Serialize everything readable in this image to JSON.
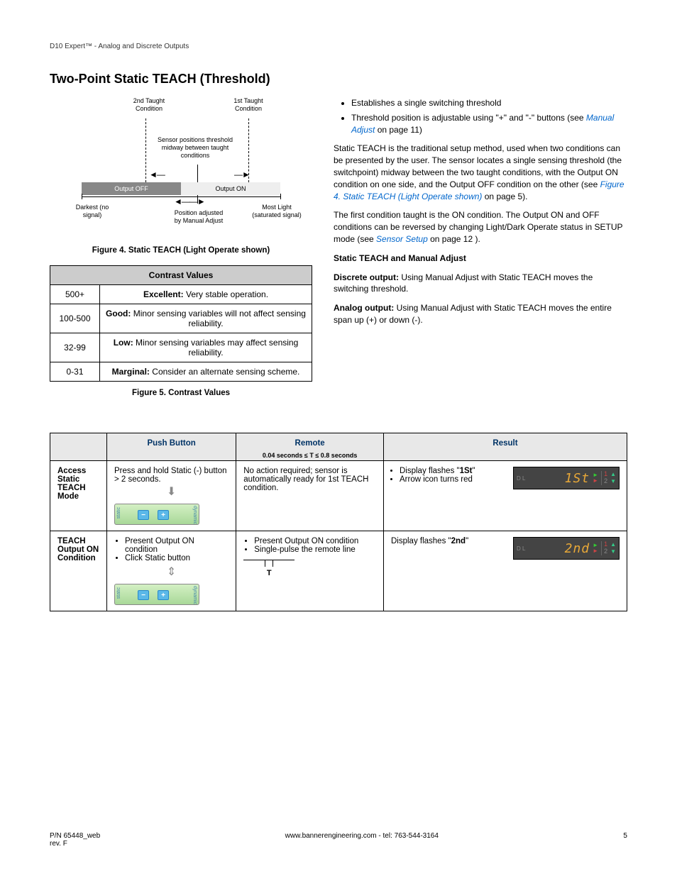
{
  "header": "D10 Expert™ - Analog and Discrete Outputs",
  "title": "Two-Point Static TEACH (Threshold)",
  "diagram": {
    "cond2": "2nd Taught Condition",
    "cond1": "1st Taught Condition",
    "mid": "Sensor positions threshold midway between taught conditions",
    "off": "Output OFF",
    "on": "Output ON",
    "dark": "Darkest (no signal)",
    "pos": "Position adjusted by Manual Adjust",
    "light": "Most Light (saturated signal)"
  },
  "fig4": "Figure 4. Static TEACH (Light Operate shown)",
  "contrast": {
    "header": "Contrast Values",
    "rows": [
      {
        "range": "500+",
        "label": "Excellent:",
        "text": " Very stable operation."
      },
      {
        "range": "100-500",
        "label": "Good:",
        "text": " Minor sensing variables will not affect sensing reliability."
      },
      {
        "range": "32-99",
        "label": "Low:",
        "text": " Minor sensing variables may affect sensing reliability."
      },
      {
        "range": "0-31",
        "label": "Marginal:",
        "text": " Consider an alternate sensing scheme."
      }
    ]
  },
  "fig5": "Figure 5. Contrast Values",
  "bullets": {
    "b1": "Establishes a single switching threshold",
    "b2a": "Threshold position is adjustable using \"+\" and \"-\" buttons (see ",
    "b2link": "Manual Adjust",
    "b2b": " on page 11)"
  },
  "para1a": "Static TEACH is the traditional setup method, used when two conditions can be presented by the user. The sensor locates a single sensing threshold (the switchpoint) midway between the two taught conditions, with the Output ON condition on one side, and the Output OFF condition on the other (see ",
  "para1link": "Figure 4. Static TEACH (Light Operate shown)",
  "para1b": " on page 5).",
  "para2a": "The first condition taught is the ON condition. The Output ON and OFF conditions can be reversed by changing Light/Dark Operate status in SETUP mode (see ",
  "para2link": "Sensor Setup",
  "para2b": " on page 12 ).",
  "subhead": "Static TEACH and Manual Adjust",
  "para3a": "Discrete output:",
  "para3b": " Using Manual Adjust with Static TEACH moves the switching threshold.",
  "para4a": "Analog output:",
  "para4b": " Using Manual Adjust with Static TEACH moves the entire span up (+) or down (-).",
  "table2": {
    "h1": "Push Button",
    "h2": "Remote",
    "h2sub": "0.04 seconds ≤ T ≤ 0.8 seconds",
    "h3": "Result",
    "row1": {
      "label": "Access Static TEACH Mode",
      "push": "Press and hold Static (-) button > 2 seconds.",
      "remote": "No action required; sensor is automatically ready for 1st TEACH condition.",
      "res_b1a": "Display flashes \"",
      "res_b1b": "1St",
      "res_b1c": "\"",
      "res_b2": "Arrow icon turns red",
      "display": "1St"
    },
    "row2": {
      "label": "TEACH Output ON Condition",
      "push_b1": "Present Output ON condition",
      "push_b2": "Click Static button",
      "remote_b1": "Present Output ON condition",
      "remote_b2": "Single-pulse the remote line",
      "remote_t": "T",
      "res_a": "Display flashes \"",
      "res_b": "2nd",
      "res_c": "\"",
      "display": "2nd"
    }
  },
  "widget": {
    "static": "static",
    "dynamic": "dynamic",
    "dl": "D L",
    "n1": "1",
    "n2": "2"
  },
  "footer": {
    "left1": "P/N 65448_web",
    "left2": "rev. F",
    "mid": "www.bannerengineering.com - tel: 763-544-3164",
    "right": "5"
  }
}
